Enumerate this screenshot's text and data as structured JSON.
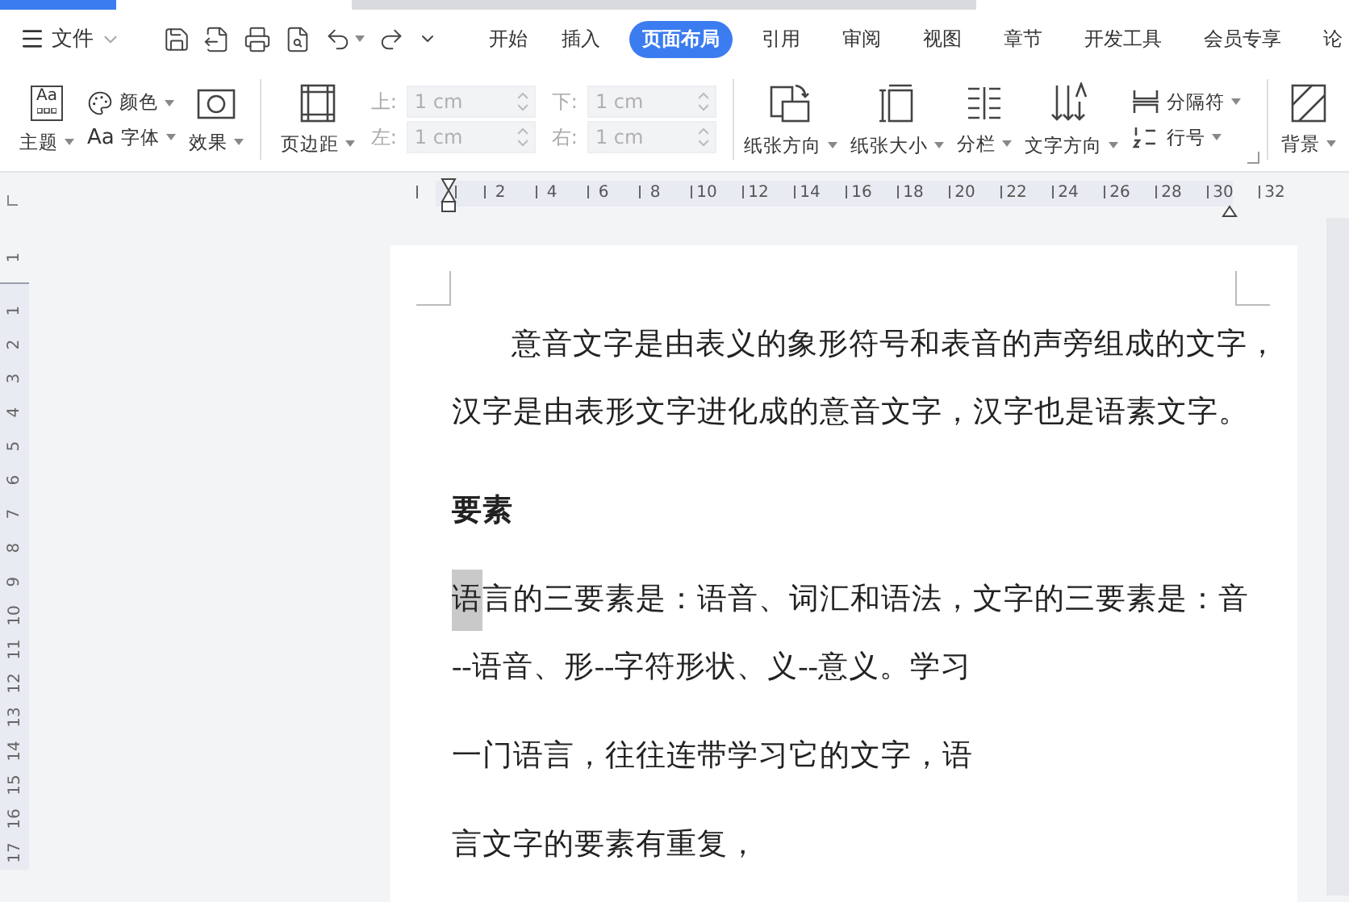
{
  "menu": {
    "label": "文件"
  },
  "tabs": [
    {
      "label": "开始",
      "selected": false
    },
    {
      "label": "插入",
      "selected": false
    },
    {
      "label": "页面布局",
      "selected": true
    },
    {
      "label": "引用",
      "selected": false
    },
    {
      "label": "审阅",
      "selected": false
    },
    {
      "label": "视图",
      "selected": false
    },
    {
      "label": "章节",
      "selected": false
    },
    {
      "label": "开发工具",
      "selected": false
    },
    {
      "label": "会员专享",
      "selected": false
    },
    {
      "label": "论",
      "selected": false
    }
  ],
  "ribbon": {
    "theme": {
      "label": "主题",
      "icon_text": "Aa"
    },
    "color": {
      "label": "颜色"
    },
    "font": {
      "label": "字体",
      "icon_text": "Aa"
    },
    "effect": {
      "label": "效果"
    },
    "margins_button": {
      "label": "页边距"
    },
    "margins": [
      {
        "label": "上:",
        "value": "1 cm",
        "disabled": true
      },
      {
        "label": "下:",
        "value": "1 cm",
        "disabled": true
      },
      {
        "label": "左:",
        "value": "1 cm",
        "disabled": true
      },
      {
        "label": "右:",
        "value": "1 cm",
        "disabled": true
      }
    ],
    "orientation": {
      "label": "纸张方向"
    },
    "size": {
      "label": "纸张大小"
    },
    "columns": {
      "label": "分栏"
    },
    "text_direction": {
      "label": "文字方向"
    },
    "breaks": {
      "label": "分隔符"
    },
    "line_numbers": {
      "label": "行号"
    },
    "background": {
      "label": "背景"
    }
  },
  "horizontal_ruler": [
    "2",
    "4",
    "6",
    "8",
    "10",
    "12",
    "14",
    "16",
    "18",
    "20",
    "22",
    "24",
    "26",
    "28",
    "30",
    "32"
  ],
  "vertical_ruler": {
    "header": "1",
    "numbers": [
      "1",
      "2",
      "3",
      "4",
      "5",
      "6",
      "7",
      "8",
      "9",
      "10",
      "11",
      "12",
      "13",
      "14",
      "15",
      "16",
      "17"
    ]
  },
  "document": [
    {
      "kind": "paragraph",
      "lines": [
        {
          "indent": true,
          "parts": [
            {
              "text": "意音文字是由表义的象形符号和表音的声旁组成的文字，",
              "selected": false
            }
          ]
        },
        {
          "indent": false,
          "parts": [
            {
              "text": "汉字是由表形文字进化成的意音文字，汉字也是语素文字。",
              "selected": false
            }
          ]
        }
      ]
    },
    {
      "kind": "heading",
      "lines": [
        {
          "indent": false,
          "parts": [
            {
              "text": "要素",
              "selected": false
            }
          ]
        }
      ]
    },
    {
      "kind": "paragraph",
      "lines": [
        {
          "indent": false,
          "parts": [
            {
              "text": "语",
              "selected": true
            },
            {
              "text": "言的三要素是：语音、词汇和语法，文字的三要素是：音",
              "selected": false
            }
          ]
        },
        {
          "indent": false,
          "parts": [
            {
              "text": "--语音、形--字符形状、义--意义。学习",
              "selected": false
            }
          ]
        }
      ]
    },
    {
      "kind": "paragraph",
      "lines": [
        {
          "indent": false,
          "parts": [
            {
              "text": "一门语言，往往连带学习它的文字，语",
              "selected": false
            }
          ]
        }
      ]
    },
    {
      "kind": "paragraph",
      "lines": [
        {
          "indent": false,
          "parts": [
            {
              "text": "言文字的要素有重复，",
              "selected": false
            }
          ]
        }
      ]
    }
  ]
}
